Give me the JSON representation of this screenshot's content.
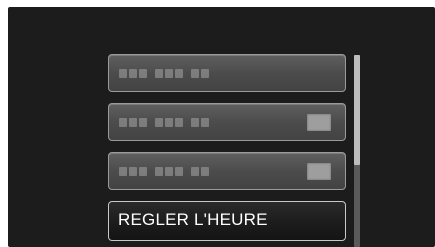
{
  "menu": {
    "items": [
      {
        "label": "",
        "placeholder_groups": [
          3,
          3,
          2
        ],
        "has_value": false
      },
      {
        "label": "",
        "placeholder_groups": [
          3,
          3,
          2
        ],
        "has_value": true
      },
      {
        "label": "",
        "placeholder_groups": [
          3,
          3,
          2
        ],
        "has_value": true
      },
      {
        "label": "REGLER L'HEURE",
        "selected": true
      }
    ]
  },
  "scrollbar": {
    "position_fraction": 0.0,
    "visible_fraction": 0.57
  },
  "colors": {
    "screen_bg": "#1c1c1c",
    "item_bg": "#4c4c4c",
    "selected_bg": "#1b1b1b",
    "text": "#ffffff",
    "scroll_thumb": "#bdbdbd",
    "scroll_track": "#5a5a5a"
  }
}
